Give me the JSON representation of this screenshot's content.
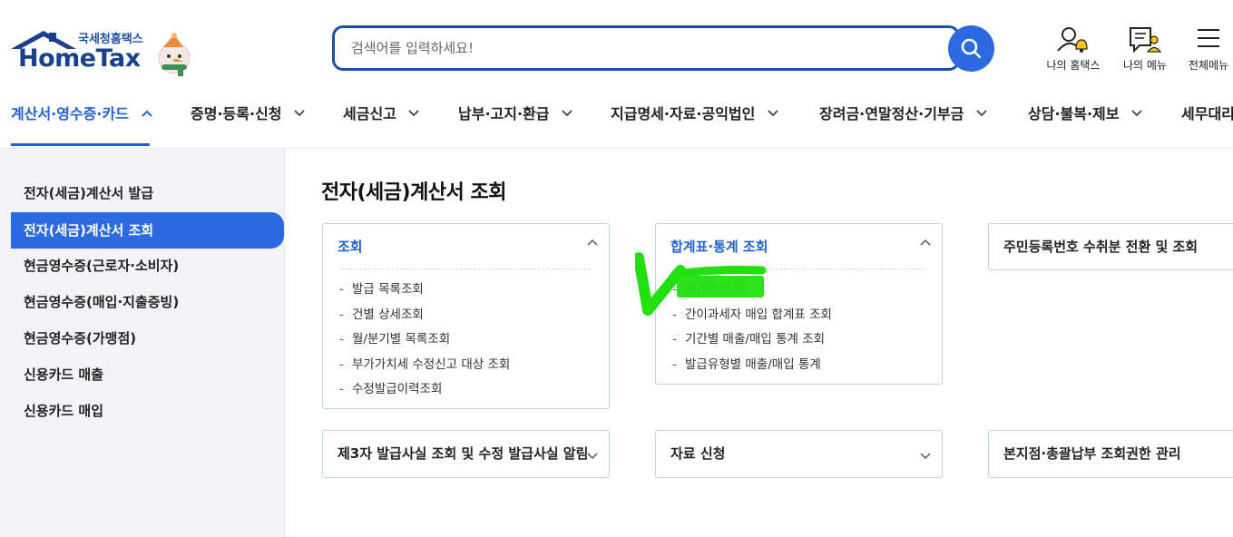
{
  "header": {
    "logo_sub": "국세청홈택스",
    "logo_main": "HomeTax",
    "search_placeholder": "검색어를 입력하세요!",
    "utils": [
      {
        "icon": "person-bell-icon",
        "label": "나의 홈택스"
      },
      {
        "icon": "document-person-icon",
        "label": "나의 메뉴"
      },
      {
        "icon": "hamburger-menu-icon",
        "label": "전체메뉴"
      }
    ],
    "colors": {
      "brand": "#1a3f8c",
      "accent": "#2b6ae0"
    }
  },
  "gnb": {
    "items": [
      {
        "label": "계산서·영수증·카드",
        "state": "active"
      },
      {
        "label": "증명·등록·신청"
      },
      {
        "label": "세금신고"
      },
      {
        "label": "납부·고지·환급"
      },
      {
        "label": "지급명세·자료·공익법인"
      },
      {
        "label": "장려금·연말정산·기부금"
      },
      {
        "label": "상담·불복·제보"
      },
      {
        "label": "세무대리"
      }
    ]
  },
  "sidebar": {
    "items": [
      {
        "label": "전자(세금)계산서 발급"
      },
      {
        "label": "전자(세금)계산서 조회",
        "state": "active"
      },
      {
        "label": "현금영수증(근로자·소비자)"
      },
      {
        "label": "현금영수증(매입·지출증빙)"
      },
      {
        "label": "현금영수증(가맹점)"
      },
      {
        "label": "신용카드 매출"
      },
      {
        "label": "신용카드 매입"
      }
    ]
  },
  "main": {
    "title": "전자(세금)계산서 조회",
    "cards": [
      {
        "title": "조회",
        "expanded": true,
        "items": [
          "발급 목록조회",
          "건별 상세조회",
          "월/분기별 목록조회",
          "부가가치세 수정신고 대상 조회",
          "수정발급이력조회"
        ]
      },
      {
        "title": "합계표·통계 조회",
        "expanded": true,
        "items": [
          "합계표 조회",
          "간이과세자 매입 합계표 조회",
          "기간별 매출/매입 통계 조회",
          "발급유형별 매출/매입 통계"
        ]
      },
      {
        "title": "주민등록번호 수취분 전환 및 조회",
        "expanded": false,
        "items": []
      },
      {
        "title": "제3자 발급사실 조회 및 수정 발급사실 알림",
        "expanded": false,
        "items": []
      },
      {
        "title": "자료 신청",
        "expanded": false,
        "items": []
      },
      {
        "title": "본지점·총괄납부 조회권한 관리",
        "expanded": false,
        "items": []
      }
    ],
    "annotation_color": "#22e010"
  }
}
